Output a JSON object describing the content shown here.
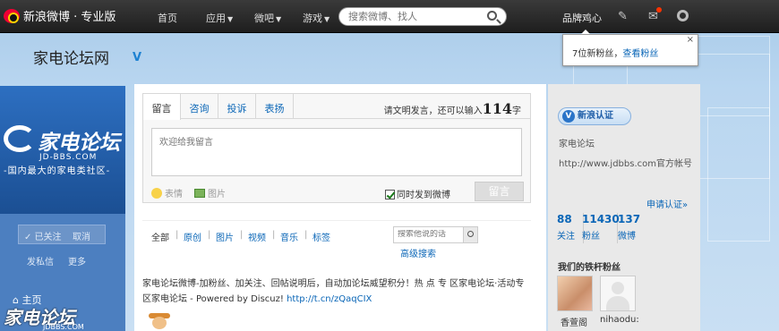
{
  "topbar": {
    "logo_text": "新浪微博 · 专业版",
    "nav": [
      "首页",
      "应用",
      "微吧",
      "游戏"
    ],
    "search_placeholder": "搜索微博、找人",
    "username": "品牌鸡心"
  },
  "notification": {
    "text": "7位新粉丝，",
    "link": "查看粉丝",
    "close": "×"
  },
  "page": {
    "title": "家电论坛网"
  },
  "left": {
    "brand_name": "家电论坛",
    "brand_url": "JD-BBS.COM",
    "slogan": "-国内最大的家电类社区-",
    "followed": "✓ 已关注",
    "unfollow": "取消",
    "message": "发私信",
    "more": "更多",
    "home": "主页",
    "brand2_name": "家电论坛",
    "brand2_url": "JDBBS.COM"
  },
  "compose": {
    "tabs": [
      "留言",
      "咨询",
      "投诉",
      "表扬"
    ],
    "limit_prefix": "请文明发言，还可以输入",
    "limit_count": "114",
    "limit_suffix": "字",
    "placeholder": "欢迎给我留言",
    "emoticon": "表情",
    "picture": "图片",
    "sync_label": "同时发到微博",
    "submit": "留言"
  },
  "filters": {
    "items": [
      "全部",
      "原创",
      "图片",
      "视频",
      "音乐",
      "标签"
    ],
    "search_placeholder": "搜索他说的话",
    "advanced": "高级搜索"
  },
  "feed": {
    "text": "家电论坛微博-加粉丝、加关注、回帖说明后，自动加论坛威望积分！热 点 专 区家电论坛·活动专区家电论坛 - Powered by Discuz! ",
    "link": "http://t.cn/zQaqCIX"
  },
  "right": {
    "verify": "新浪认证",
    "name": "家电论坛",
    "desc": "http://www.jdbbs.com官方帐号",
    "apply": "申请认证»",
    "stats": [
      {
        "num": "88",
        "label": "关注"
      },
      {
        "num": "11430",
        "label": "粉丝"
      },
      {
        "num": "137",
        "label": "微博"
      }
    ],
    "fans_title": "我们的铁杆粉丝",
    "fans": [
      "香萱阁",
      "nihaodu:"
    ]
  }
}
